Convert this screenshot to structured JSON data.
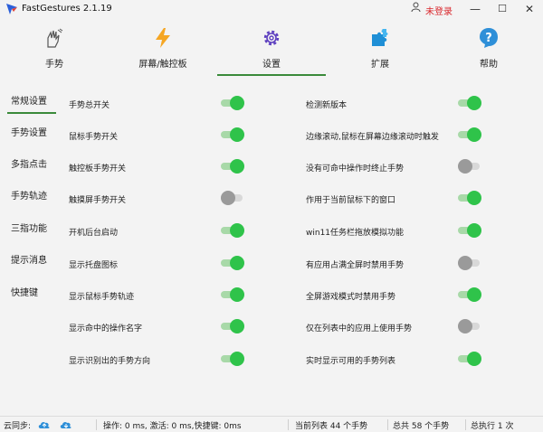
{
  "window": {
    "title": "FastGestures 2.1.19",
    "login_status": "未登录",
    "user_icon": "user-icon",
    "min_glyph": "—",
    "max_glyph": "☐",
    "close_glyph": "✕"
  },
  "tabs": [
    {
      "label": "手势",
      "icon": "hand-gesture-icon",
      "active": false
    },
    {
      "label": "屏幕/触控板",
      "icon": "lightning-icon",
      "active": false
    },
    {
      "label": "设置",
      "icon": "gear-icon",
      "active": true
    },
    {
      "label": "扩展",
      "icon": "puzzle-icon",
      "active": false
    },
    {
      "label": "帮助",
      "icon": "help-icon",
      "active": false
    }
  ],
  "sidebar": {
    "items": [
      {
        "label": "常规设置",
        "active": true
      },
      {
        "label": "手势设置",
        "active": false
      },
      {
        "label": "多指点击",
        "active": false
      },
      {
        "label": "手势轨迹",
        "active": false
      },
      {
        "label": "三指功能",
        "active": false
      },
      {
        "label": "提示消息",
        "active": false
      },
      {
        "label": "快捷键",
        "active": false
      }
    ]
  },
  "settings": {
    "left": [
      {
        "label": "手势总开关",
        "on": true
      },
      {
        "label": "鼠标手势开关",
        "on": true
      },
      {
        "label": "触控板手势开关",
        "on": true
      },
      {
        "label": "触摸屏手势开关",
        "on": false
      },
      {
        "label": "开机后台启动",
        "on": true
      },
      {
        "label": "显示托盘图标",
        "on": true
      },
      {
        "label": "显示鼠标手势轨迹",
        "on": true
      },
      {
        "label": "显示命中的操作名字",
        "on": true
      },
      {
        "label": "显示识别出的手势方向",
        "on": true
      }
    ],
    "right": [
      {
        "label": "检测新版本",
        "on": true
      },
      {
        "label": "边缘滚动,鼠标在屏幕边缘滚动时触发",
        "on": true
      },
      {
        "label": "没有可命中操作时终止手势",
        "on": false
      },
      {
        "label": "作用于当前鼠标下的窗口",
        "on": true
      },
      {
        "label": "win11任务栏拖放模拟功能",
        "on": true
      },
      {
        "label": "有应用占满全屏时禁用手势",
        "on": false
      },
      {
        "label": "全屏游戏模式时禁用手势",
        "on": true
      },
      {
        "label": "仅在列表中的应用上使用手势",
        "on": false
      },
      {
        "label": "实时显示可用的手势列表",
        "on": true
      }
    ]
  },
  "statusbar": {
    "cloud_sync_label": "云同步:",
    "upload_icon": "cloud-upload-icon",
    "download_icon": "cloud-download-icon",
    "stats": "操作: 0 ms, 激活: 0 ms,快捷键: 0ms",
    "current_list": "当前列表 44 个手势",
    "total": "总共 58 个手势",
    "executed": "总执行 1 次"
  },
  "colors": {
    "accent_green": "#2fc34a",
    "active_underline": "#3a8a3a",
    "login_red": "#d9262b"
  }
}
